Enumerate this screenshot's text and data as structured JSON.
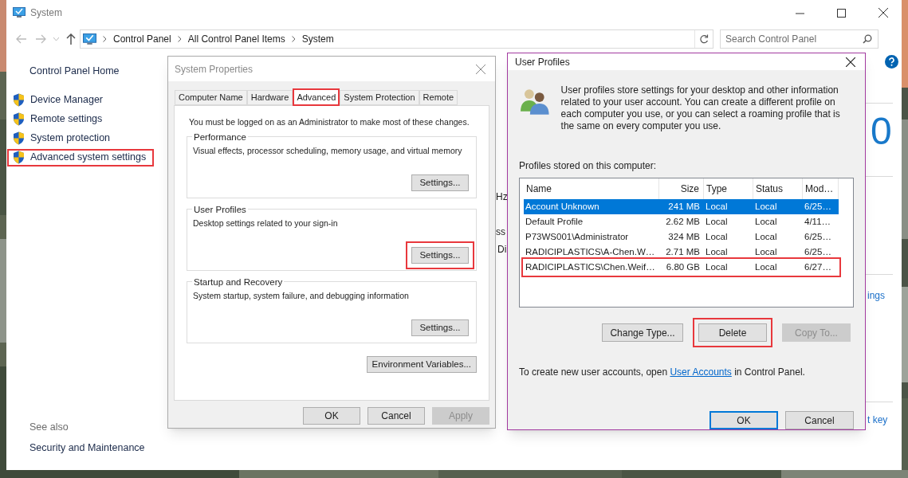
{
  "window": {
    "title": "System"
  },
  "address_bar": {
    "crumbs": [
      "Control Panel",
      "All Control Panel Items",
      "System"
    ]
  },
  "search": {
    "placeholder": "Search Control Panel"
  },
  "sidebar": {
    "home": "Control Panel Home",
    "items": [
      {
        "label": "Device Manager",
        "highlighted": false
      },
      {
        "label": "Remote settings",
        "highlighted": false
      },
      {
        "label": "System protection",
        "highlighted": false
      },
      {
        "label": "Advanced system settings",
        "highlighted": true
      }
    ],
    "see_also": "See also",
    "see_also_items": [
      "Security and Maintenance"
    ]
  },
  "background_fragments": [
    {
      "kind": "text",
      "text": "Hz"
    },
    {
      "kind": "text",
      "text": "ss"
    },
    {
      "kind": "text",
      "text": "Di"
    },
    {
      "kind": "number",
      "text": "0"
    },
    {
      "kind": "link",
      "text": "ings"
    },
    {
      "kind": "link",
      "text": "t key"
    }
  ],
  "system_properties": {
    "title": "System Properties",
    "tabs": [
      {
        "label": "Computer Name",
        "selected": false,
        "highlighted": false
      },
      {
        "label": "Hardware",
        "selected": false,
        "highlighted": false
      },
      {
        "label": "Advanced",
        "selected": true,
        "highlighted": true
      },
      {
        "label": "System Protection",
        "selected": false,
        "highlighted": false
      },
      {
        "label": "Remote",
        "selected": false,
        "highlighted": false
      }
    ],
    "notice": "You must be logged on as an Administrator to make most of these changes.",
    "groups": [
      {
        "title": "Performance",
        "description": "Visual effects, processor scheduling, memory usage, and virtual memory",
        "button": {
          "label": "Settings...",
          "highlighted": false
        }
      },
      {
        "title": "User Profiles",
        "description": "Desktop settings related to your sign-in",
        "button": {
          "label": "Settings...",
          "highlighted": true
        }
      },
      {
        "title": "Startup and Recovery",
        "description": "System startup, system failure, and debugging information",
        "button": {
          "label": "Settings...",
          "highlighted": false
        }
      }
    ],
    "env_button": "Environment Variables...",
    "buttons": [
      {
        "label": "OK",
        "disabled": false
      },
      {
        "label": "Cancel",
        "disabled": false
      },
      {
        "label": "Apply",
        "disabled": true
      }
    ]
  },
  "user_profiles": {
    "title": "User Profiles",
    "description": "User profiles store settings for your desktop and other information related to your user account. You can create a different profile on each computer you use, or you can select a roaming profile that is the same on every computer you use.",
    "list_label": "Profiles stored on this computer:",
    "columns": [
      "Name",
      "Size",
      "Type",
      "Status",
      "Mod…"
    ],
    "rows": [
      {
        "cells": [
          "Account Unknown",
          "241 MB",
          "Local",
          "Local",
          "6/25…"
        ],
        "selected": true,
        "highlighted": false
      },
      {
        "cells": [
          "Default Profile",
          "2.62 MB",
          "Local",
          "Local",
          "4/11…"
        ],
        "selected": false,
        "highlighted": false
      },
      {
        "cells": [
          "P73WS001\\Administrator",
          "324 MB",
          "Local",
          "Local",
          "6/25…"
        ],
        "selected": false,
        "highlighted": false
      },
      {
        "cells": [
          "RADICIPLASTICS\\A-Chen.W…",
          "2.71 MB",
          "Local",
          "Local",
          "6/25…"
        ],
        "selected": false,
        "highlighted": false
      },
      {
        "cells": [
          "RADICIPLASTICS\\Chen.Weif…",
          "6.80 GB",
          "Local",
          "Local",
          "6/27…"
        ],
        "selected": false,
        "highlighted": true
      }
    ],
    "actions": [
      {
        "label": "Change Type...",
        "disabled": false,
        "highlighted": false
      },
      {
        "label": "Delete",
        "disabled": false,
        "highlighted": true
      },
      {
        "label": "Copy To...",
        "disabled": true,
        "highlighted": false
      }
    ],
    "footer": {
      "before": "To create new user accounts, open ",
      "link": "User Accounts",
      "after": " in Control Panel."
    },
    "buttons": [
      {
        "label": "OK",
        "default": true
      },
      {
        "label": "Cancel",
        "default": false
      }
    ]
  }
}
